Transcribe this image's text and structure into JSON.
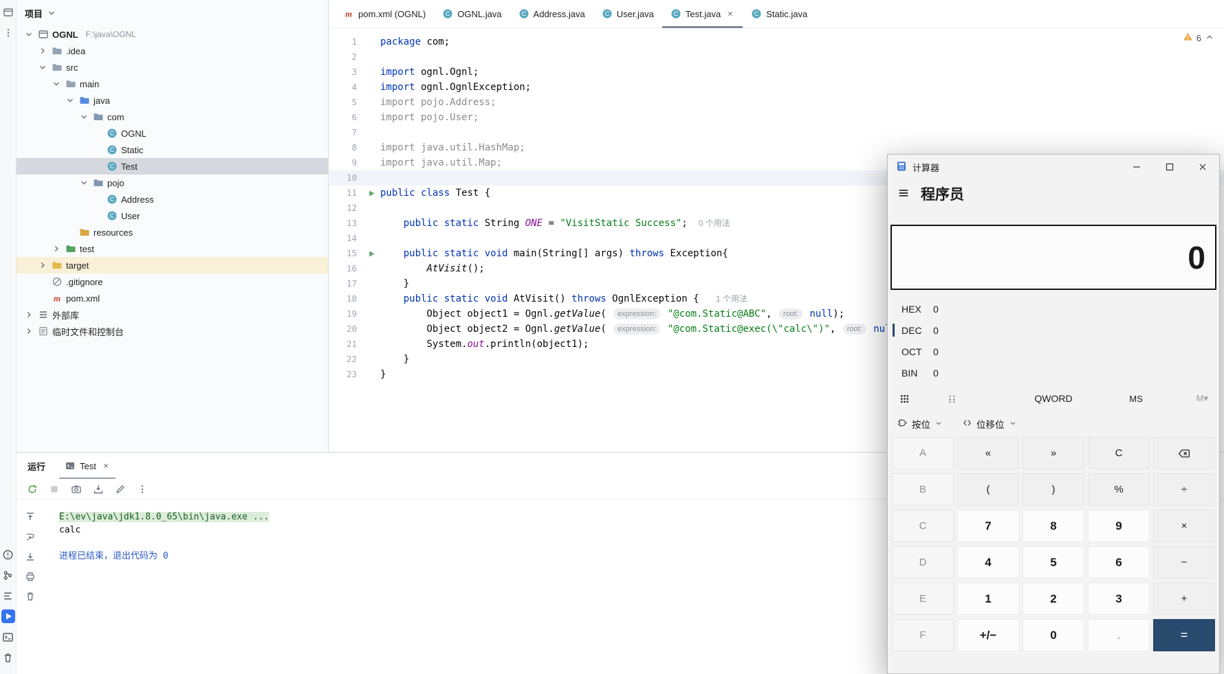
{
  "activity_bar": {
    "top": [
      {
        "icon": "project",
        "active": false
      },
      {
        "icon": "more-dots",
        "active": false
      }
    ],
    "bottom": [
      {
        "icon": "problems",
        "active": false
      },
      {
        "icon": "vcs",
        "active": false
      },
      {
        "icon": "structure",
        "active": false
      },
      {
        "icon": "run",
        "active": true
      },
      {
        "icon": "terminal",
        "active": false
      },
      {
        "icon": "trash",
        "active": false
      }
    ]
  },
  "project": {
    "title": "项目",
    "tree": [
      {
        "level": 0,
        "label": "OGNL",
        "extra": "F:\\java\\OGNL",
        "icon": "project",
        "chevron": "expanded",
        "bold": true
      },
      {
        "level": 1,
        "label": ".idea",
        "icon": "folder",
        "chevron": "collapsed"
      },
      {
        "level": 1,
        "label": "src",
        "icon": "folder",
        "chevron": "expanded"
      },
      {
        "level": 2,
        "label": "main",
        "icon": "folder",
        "chevron": "expanded"
      },
      {
        "level": 3,
        "label": "java",
        "icon": "folder-src",
        "chevron": "expanded"
      },
      {
        "level": 4,
        "label": "com",
        "icon": "package",
        "chevron": "expanded"
      },
      {
        "level": 5,
        "label": "OGNL",
        "icon": "class"
      },
      {
        "level": 5,
        "label": "Static",
        "icon": "class"
      },
      {
        "level": 5,
        "label": "Test",
        "icon": "class",
        "selected": true
      },
      {
        "level": 4,
        "label": "pojo",
        "icon": "package",
        "chevron": "expanded"
      },
      {
        "level": 5,
        "label": "Address",
        "icon": "class"
      },
      {
        "level": 5,
        "label": "User",
        "icon": "class"
      },
      {
        "level": 3,
        "label": "resources",
        "icon": "folder-res"
      },
      {
        "level": 2,
        "label": "test",
        "icon": "folder-test",
        "chevron": "collapsed"
      },
      {
        "level": 1,
        "label": "target",
        "icon": "folder-excluded",
        "chevron": "collapsed",
        "warm": true
      },
      {
        "level": 1,
        "label": ".gitignore",
        "icon": "ignored"
      },
      {
        "level": 1,
        "label": "pom.xml",
        "icon": "maven"
      },
      {
        "level": 0,
        "label": "外部库",
        "icon": "libraries",
        "chevron": "collapsed"
      },
      {
        "level": 0,
        "label": "临时文件和控制台",
        "icon": "scratches",
        "chevron": "collapsed"
      }
    ]
  },
  "tabs": [
    {
      "label": "pom.xml (OGNL)",
      "icon": "maven",
      "active": false
    },
    {
      "label": "OGNL.java",
      "icon": "class",
      "active": false
    },
    {
      "label": "Address.java",
      "icon": "class",
      "active": false
    },
    {
      "label": "User.java",
      "icon": "class",
      "active": false
    },
    {
      "label": "Test.java",
      "icon": "class",
      "active": true
    },
    {
      "label": "Static.java",
      "icon": "class",
      "active": false
    }
  ],
  "editor": {
    "warnings": "6",
    "lines": [
      {
        "n": 1,
        "seg": [
          [
            "k",
            "package"
          ],
          [
            "d",
            " com;"
          ]
        ]
      },
      {
        "n": 2,
        "seg": []
      },
      {
        "n": 3,
        "seg": [
          [
            "k",
            "import"
          ],
          [
            "d",
            " ognl.Ognl;"
          ]
        ]
      },
      {
        "n": 4,
        "seg": [
          [
            "k",
            "import"
          ],
          [
            "d",
            " ognl.OgnlException;"
          ]
        ]
      },
      {
        "n": 5,
        "seg": [
          [
            "gy",
            "import pojo.Address;"
          ]
        ]
      },
      {
        "n": 6,
        "seg": [
          [
            "gy",
            "import pojo.User;"
          ]
        ]
      },
      {
        "n": 7,
        "seg": []
      },
      {
        "n": 8,
        "seg": [
          [
            "gy",
            "import java.util.HashMap;"
          ]
        ]
      },
      {
        "n": 9,
        "seg": [
          [
            "gy",
            "import java.util.Map;"
          ]
        ]
      },
      {
        "n": 10,
        "seg": [],
        "caret": true
      },
      {
        "n": 11,
        "seg": [
          [
            "k",
            "public class"
          ],
          [
            "d",
            " Test {"
          ]
        ],
        "run": true
      },
      {
        "n": 12,
        "seg": []
      },
      {
        "n": 13,
        "seg": [
          [
            "d",
            "    "
          ],
          [
            "k",
            "public static"
          ],
          [
            "d",
            " String "
          ],
          [
            "sf",
            "ONE"
          ],
          [
            "d",
            " = "
          ],
          [
            "s",
            "\"VisitStatic Success\""
          ],
          [
            "d",
            ";"
          ],
          [
            "u",
            "0 个用法"
          ]
        ]
      },
      {
        "n": 14,
        "seg": []
      },
      {
        "n": 15,
        "seg": [
          [
            "d",
            "    "
          ],
          [
            "k",
            "public static void"
          ],
          [
            "d",
            " main(String[] args) "
          ],
          [
            "k",
            "throws"
          ],
          [
            "d",
            " Exception{"
          ]
        ],
        "run": true
      },
      {
        "n": 16,
        "seg": [
          [
            "d",
            "        "
          ],
          [
            "sm",
            "AtVisit"
          ],
          [
            "d",
            "();"
          ]
        ]
      },
      {
        "n": 17,
        "seg": [
          [
            "d",
            "    }"
          ]
        ]
      },
      {
        "n": 18,
        "seg": [
          [
            "d",
            "    "
          ],
          [
            "k",
            "public static void"
          ],
          [
            "d",
            " AtVisit() "
          ],
          [
            "k",
            "throws"
          ],
          [
            "d",
            " OgnlException { "
          ],
          [
            "u",
            "1 个用法"
          ]
        ]
      },
      {
        "n": 19,
        "seg": [
          [
            "d",
            "        Object object1 = Ognl."
          ],
          [
            "sm",
            "getValue"
          ],
          [
            "d",
            "( "
          ],
          [
            "ph",
            "expression:"
          ],
          [
            "d",
            " "
          ],
          [
            "s",
            "\"@com.Static@ABC\""
          ],
          [
            "d",
            ", "
          ],
          [
            "ph",
            "root:"
          ],
          [
            "d",
            " "
          ],
          [
            "k",
            "null"
          ],
          [
            "d",
            ");"
          ]
        ]
      },
      {
        "n": 20,
        "seg": [
          [
            "d",
            "        Object object2 = Ognl."
          ],
          [
            "sm",
            "getValue"
          ],
          [
            "d",
            "( "
          ],
          [
            "ph",
            "expression:"
          ],
          [
            "d",
            " "
          ],
          [
            "s",
            "\"@com.Static@exec(\\\"calc\\\")\""
          ],
          [
            "d",
            ", "
          ],
          [
            "ph",
            "root:"
          ],
          [
            "d",
            " "
          ],
          [
            "k",
            "null"
          ],
          [
            "d",
            ");"
          ]
        ]
      },
      {
        "n": 21,
        "seg": [
          [
            "d",
            "        System."
          ],
          [
            "sf",
            "out"
          ],
          [
            "d",
            ".println(object1);"
          ]
        ]
      },
      {
        "n": 22,
        "seg": [
          [
            "d",
            "    }"
          ]
        ]
      },
      {
        "n": 23,
        "seg": [
          [
            "d",
            "}"
          ]
        ]
      }
    ]
  },
  "run": {
    "title": "运行",
    "tab": {
      "label": "Test",
      "icon": "console"
    },
    "toolbar": [
      {
        "icon": "rerun"
      },
      {
        "icon": "stop"
      },
      {
        "icon": "camera"
      },
      {
        "icon": "tray"
      },
      {
        "icon": "pencil"
      },
      {
        "icon": "more-dots"
      }
    ],
    "gutter": [
      {
        "icon": "scroll-top"
      },
      {
        "icon": "softwrap"
      },
      {
        "icon": "scroll-end"
      },
      {
        "icon": "print"
      },
      {
        "icon": "clear"
      }
    ],
    "console": [
      {
        "style": "cmd",
        "text": "E:\\ev\\java\\jdk1.8.0_65\\bin\\java.exe ..."
      },
      {
        "style": "plain",
        "text": "calc"
      },
      {
        "style": "plain",
        "text": ""
      },
      {
        "style": "sys",
        "text": "进程已结束，退出代码为 0"
      }
    ]
  },
  "calculator": {
    "title": "计算器",
    "mode": "程序员",
    "display": "0",
    "radix": [
      {
        "label": "HEX",
        "value": "0",
        "active": false
      },
      {
        "label": "DEC",
        "value": "0",
        "active": true
      },
      {
        "label": "OCT",
        "value": "0",
        "active": false
      },
      {
        "label": "BIN",
        "value": "0",
        "active": false
      }
    ],
    "toolbar": {
      "word": "QWORD",
      "ms": "MS",
      "m": "M▾"
    },
    "dropdowns": [
      {
        "icon": "gate",
        "label": "按位"
      },
      {
        "icon": "shift",
        "label": "位移位"
      }
    ],
    "window_controls": [
      {
        "icon": "minimize"
      },
      {
        "icon": "maximize"
      },
      {
        "icon": "close"
      }
    ],
    "keys": [
      [
        {
          "t": "A",
          "k": "hex"
        },
        {
          "t": "«",
          "k": "op"
        },
        {
          "t": "»",
          "k": "op"
        },
        {
          "t": "C",
          "k": "op"
        },
        {
          "t": "",
          "k": "op",
          "icon": "backspace"
        }
      ],
      [
        {
          "t": "B",
          "k": "hex"
        },
        {
          "t": "(",
          "k": "op"
        },
        {
          "t": ")",
          "k": "op"
        },
        {
          "t": "%",
          "k": "op"
        },
        {
          "t": "÷",
          "k": "op"
        }
      ],
      [
        {
          "t": "C",
          "k": "hex"
        },
        {
          "t": "7",
          "k": "num"
        },
        {
          "t": "8",
          "k": "num"
        },
        {
          "t": "9",
          "k": "num"
        },
        {
          "t": "×",
          "k": "op"
        }
      ],
      [
        {
          "t": "D",
          "k": "hex"
        },
        {
          "t": "4",
          "k": "num"
        },
        {
          "t": "5",
          "k": "num"
        },
        {
          "t": "6",
          "k": "num"
        },
        {
          "t": "−",
          "k": "op"
        }
      ],
      [
        {
          "t": "E",
          "k": "hex"
        },
        {
          "t": "1",
          "k": "num"
        },
        {
          "t": "2",
          "k": "num"
        },
        {
          "t": "3",
          "k": "num"
        },
        {
          "t": "+",
          "k": "op"
        }
      ],
      [
        {
          "t": "F",
          "k": "hex"
        },
        {
          "t": "+/−",
          "k": "num"
        },
        {
          "t": "0",
          "k": "num"
        },
        {
          "t": ".",
          "k": "num dis"
        },
        {
          "t": "=",
          "k": "eq"
        }
      ]
    ]
  }
}
